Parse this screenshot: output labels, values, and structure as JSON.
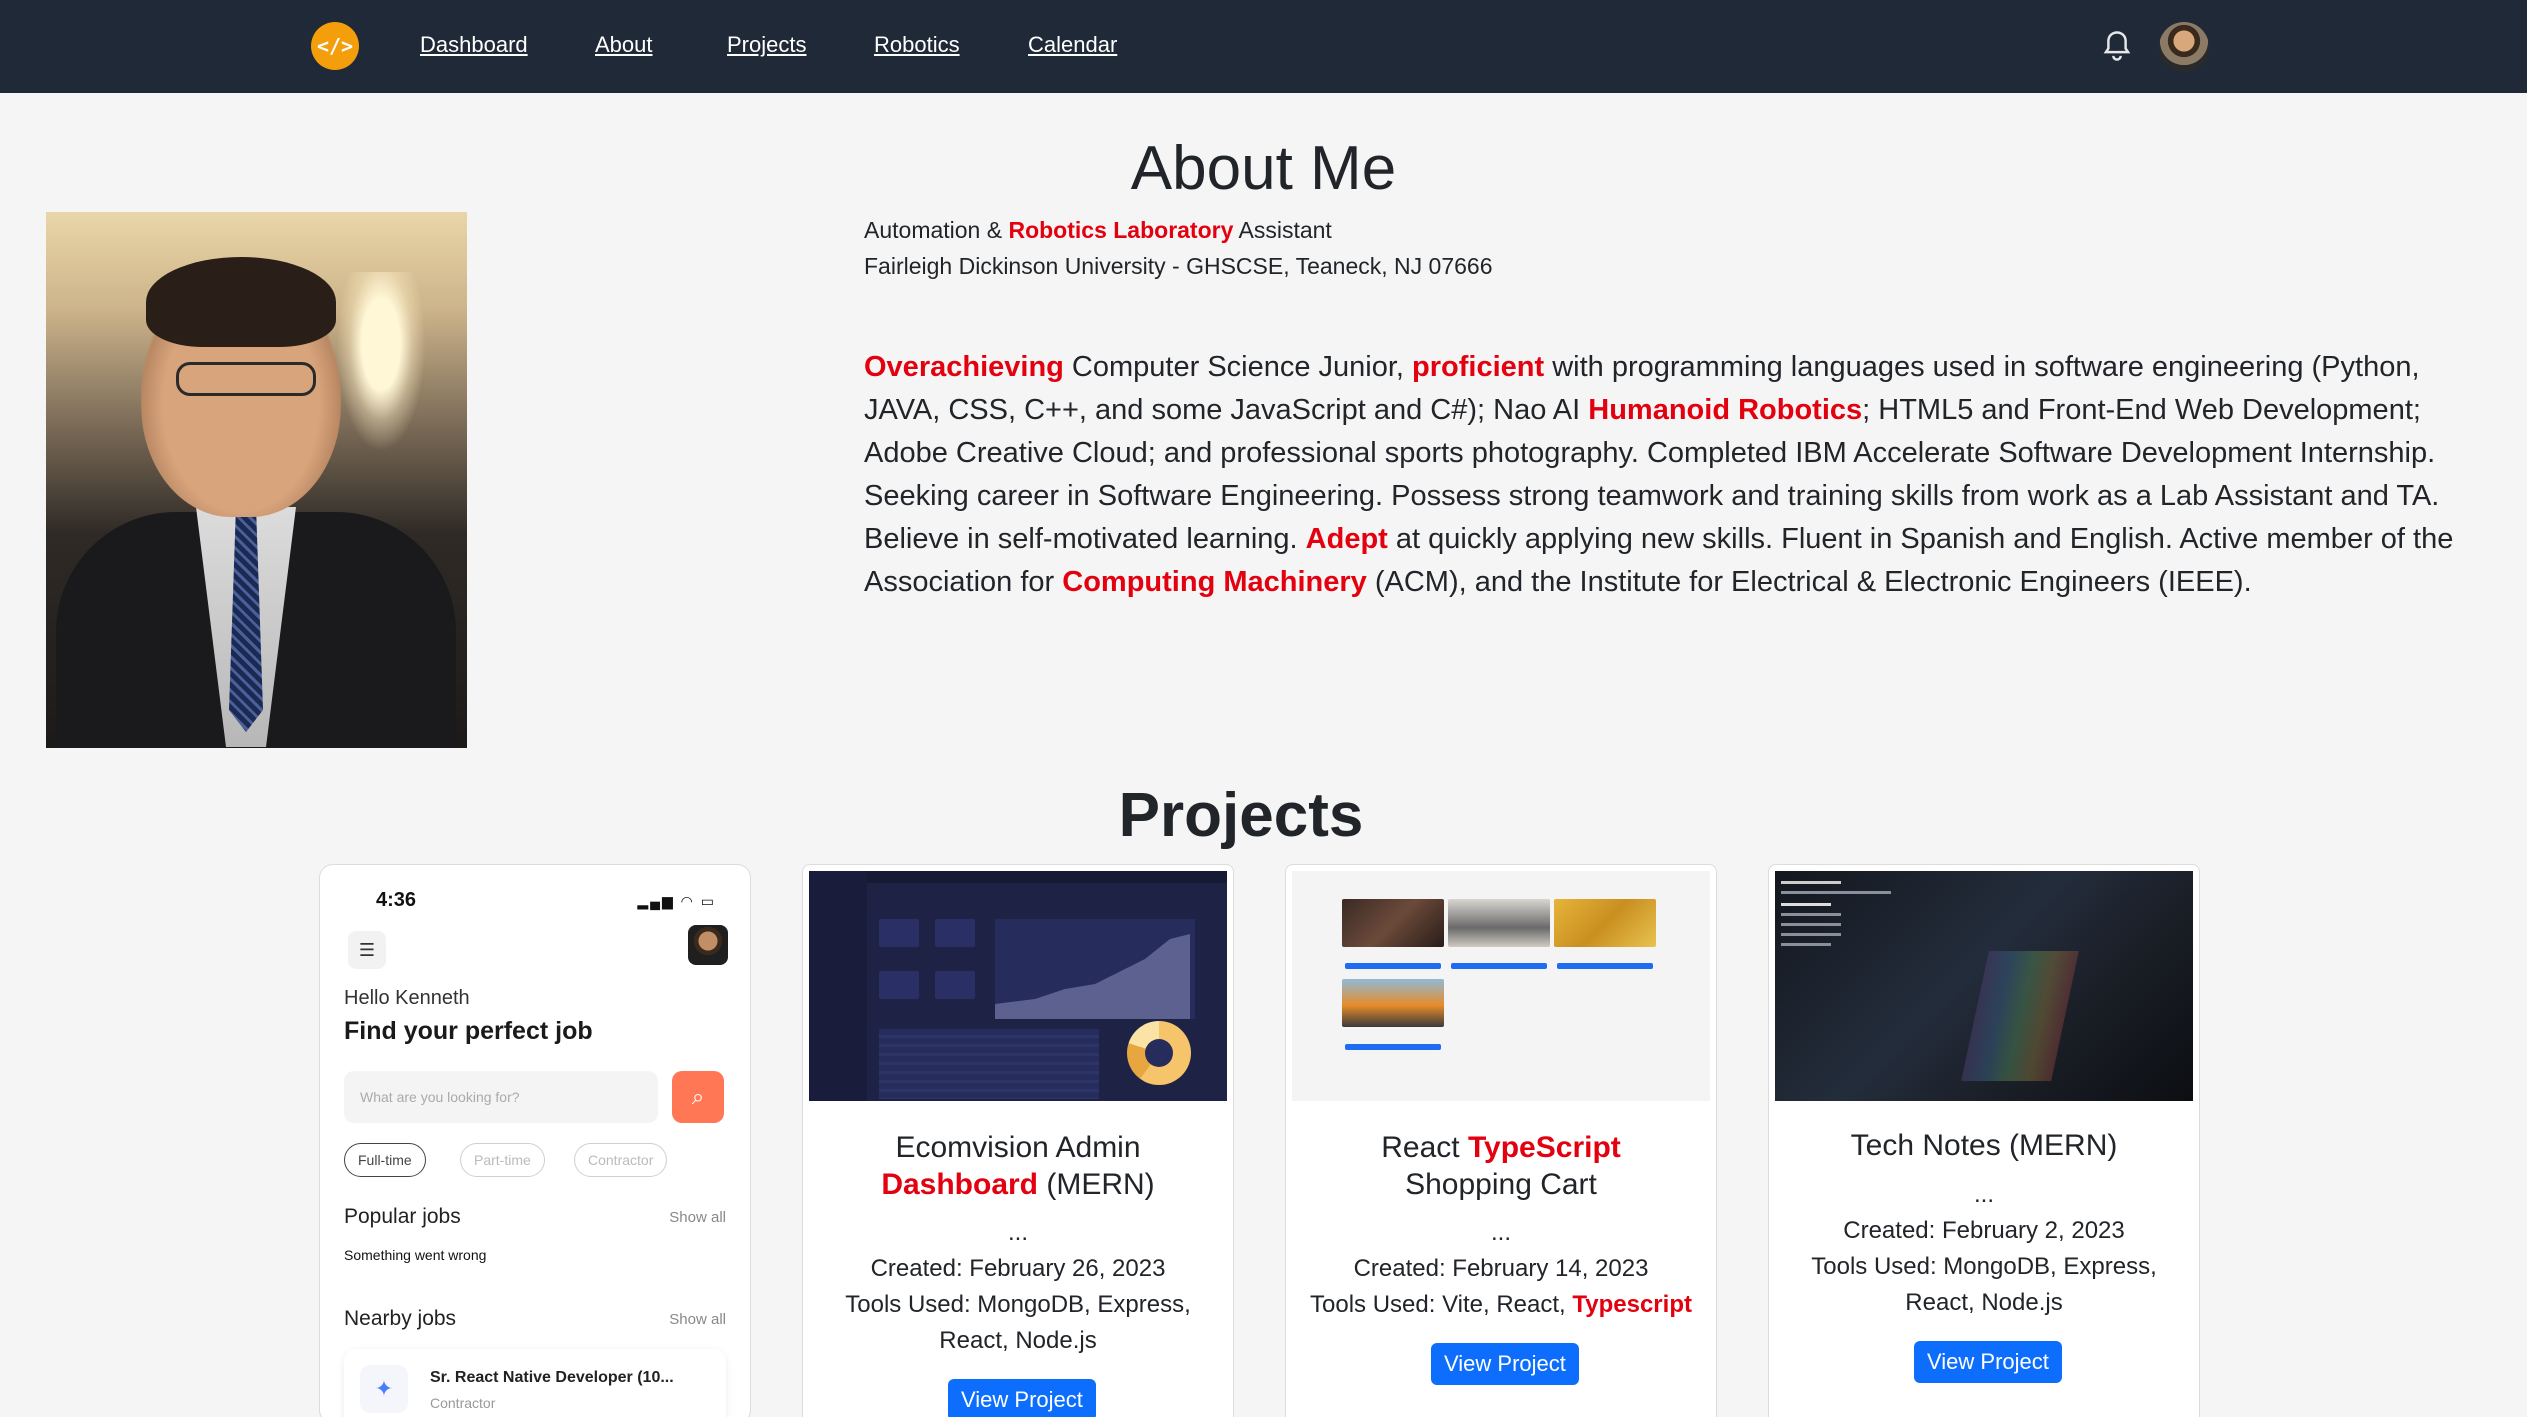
{
  "nav": {
    "logo_icon": "code-icon",
    "links": [
      "Dashboard",
      "About",
      "Projects",
      "Robotics",
      "Calendar"
    ],
    "bell_icon": "bell-icon"
  },
  "about": {
    "title": "About Me",
    "role_prefix": "Automation & ",
    "role_highlight": "Robotics Laboratory",
    "role_suffix": " Assistant",
    "university": "Fairleigh Dickinson University - GHSCSE, Teaneck, NJ 07666",
    "bio": [
      {
        "t": "Overachieving",
        "hl": true
      },
      {
        "t": " Computer Science Junior, ",
        "hl": false
      },
      {
        "t": "proficient",
        "hl": true
      },
      {
        "t": " with programming languages used in software engineering (Python, JAVA, CSS, C++, and some JavaScript and C#); Nao AI ",
        "hl": false
      },
      {
        "t": "Humanoid Robotics",
        "hl": true
      },
      {
        "t": "; HTML5 and Front-End Web Development; Adobe Creative Cloud; and professional sports photography. Completed IBM Accelerate Software Development Internship. Seeking career in Software Engineering. Possess strong teamwork and training skills from work as a Lab Assistant and TA. Believe in self-motivated learning. ",
        "hl": false
      },
      {
        "t": "Adept",
        "hl": true
      },
      {
        "t": " at quickly applying new skills. Fluent in Spanish and English. Active member of the Association for ",
        "hl": false
      },
      {
        "t": "Computing Machinery",
        "hl": true
      },
      {
        "t": " (ACM), and the Institute for Electrical & Electronic Engineers (IEEE).",
        "hl": false
      }
    ]
  },
  "projects": {
    "title": "Projects",
    "phone": {
      "time": "4:36",
      "hello": "Hello Kenneth",
      "headline": "Find your perfect job",
      "search_placeholder": "What are you looking for?",
      "chips": [
        "Full-time",
        "Part-time",
        "Contractor"
      ],
      "popular": "Popular jobs",
      "show_all": "Show all",
      "error": "Something went wrong",
      "nearby": "Nearby jobs",
      "job_title": "Sr. React Native Developer (10...",
      "job_type": "Contractor"
    },
    "cards": [
      {
        "title_plain_1": "Ecomvision Admin",
        "title_highlight": "Dashboard",
        "title_plain_2": " (MERN)",
        "dots": "...",
        "created": "Created: February 26, 2023",
        "tools": "Tools Used: MongoDB, Express, React, Node.js",
        "button": "View Project"
      },
      {
        "title_plain_1": "React ",
        "title_highlight": "TypeScript",
        "title_plain_2": "Shopping Cart",
        "dots": "...",
        "created": "Created: February 14, 2023",
        "tools_plain": "Tools Used: Vite, React, ",
        "tools_highlight": "Typescript",
        "button": "View Project"
      },
      {
        "title": "Tech Notes (MERN)",
        "dots": "...",
        "created": "Created: February 2, 2023",
        "tools": "Tools Used: MongoDB, Express, React, Node.js",
        "button": "View Project"
      }
    ]
  },
  "colors": {
    "navbar": "#1f2937",
    "accent_red": "#e3000f",
    "button_blue": "#0d6efd",
    "logo_orange": "#f59e0b"
  }
}
